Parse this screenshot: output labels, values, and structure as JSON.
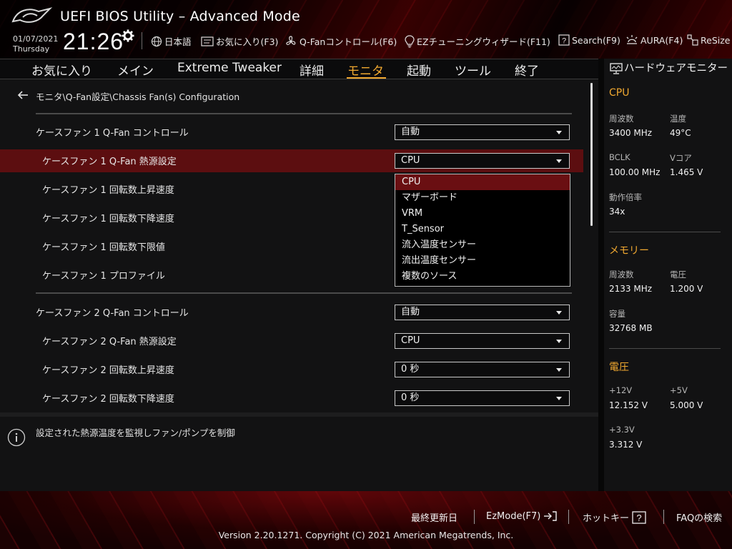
{
  "header": {
    "title": "UEFI BIOS Utility – Advanced Mode",
    "date": "01/07/2021",
    "weekday": "Thursday",
    "time": "21:26",
    "items": [
      {
        "label": "日本語",
        "icon": "globe-icon"
      },
      {
        "label": "お気に入り(F3)",
        "icon": "favorites-icon"
      },
      {
        "label": "Q-Fanコントロール(F6)",
        "icon": "fan-icon"
      },
      {
        "label": "EZチューニングウィザード(F11)",
        "icon": "bulb-icon"
      },
      {
        "label": "Search(F9)",
        "icon": "search-help-icon"
      },
      {
        "label": "AURA(F4)",
        "icon": "aura-icon"
      },
      {
        "label": "ReSize",
        "icon": "resize-icon"
      }
    ]
  },
  "nav": {
    "tabs": [
      "お気に入り",
      "メイン",
      "Extreme Tweaker",
      "詳細",
      "モニタ",
      "起動",
      "ツール",
      "終了"
    ],
    "active": "モニタ"
  },
  "main": {
    "breadcrumb": "モニタ\\Q-Fan設定\\Chassis Fan(s) Configuration",
    "rows": [
      {
        "label": "ケースファン 1 Q-Fan コントロール",
        "value": "自動"
      },
      {
        "label": "ケースファン 1 Q-Fan 熱源設定",
        "value": "CPU"
      },
      {
        "label": "ケースファン 1 回転数上昇速度",
        "value": ""
      },
      {
        "label": "ケースファン 1 回転数下降速度",
        "value": ""
      },
      {
        "label": "ケースファン 1 回転数下限値",
        "value": ""
      },
      {
        "label": "ケースファン 1 プロファイル",
        "value": ""
      },
      {
        "label": "ケースファン 2 Q-Fan コントロール",
        "value": "自動"
      },
      {
        "label": "ケースファン 2 Q-Fan 熱源設定",
        "value": "CPU"
      },
      {
        "label": "ケースファン 2 回転数上昇速度",
        "value": "0 秒"
      },
      {
        "label": "ケースファン 2 回転数下降速度",
        "value": "0 秒"
      }
    ],
    "dropdown_options": [
      "CPU",
      "マザーボード",
      "VRM",
      "T_Sensor",
      "流入温度センサー",
      "流出温度センサー",
      "複数のソース"
    ],
    "dropdown_selected": "CPU"
  },
  "help": {
    "text": "設定された熱源温度を監視しファン/ポンプを制御"
  },
  "hwmon": {
    "title": "ハードウェアモニター",
    "cpu": {
      "heading": "CPU",
      "freq_label": "周波数",
      "freq_value": "3400 MHz",
      "temp_label": "温度",
      "temp_value": "49°C",
      "bclk_label": "BCLK",
      "bclk_value": "100.00 MHz",
      "vcore_label": "Vコア",
      "vcore_value": "1.465 V",
      "ratio_label": "動作倍率",
      "ratio_value": "34x"
    },
    "memory": {
      "heading": "メモリー",
      "freq_label": "周波数",
      "freq_value": "2133 MHz",
      "volt_label": "電圧",
      "volt_value": "1.200 V",
      "cap_label": "容量",
      "cap_value": "32768 MB"
    },
    "voltage": {
      "heading": "電圧",
      "v12_label": "+12V",
      "v12_value": "12.152 V",
      "v5_label": "+5V",
      "v5_value": "5.000 V",
      "v33_label": "+3.3V",
      "v33_value": "3.312 V"
    }
  },
  "footer": {
    "last_modified": "最終更新日",
    "ezmode": "EzMode(F7)",
    "hotkeys": "ホットキー",
    "faq": "FAQの検索",
    "version": "Version 2.20.1271. Copyright (C) 2021 American Megatrends, Inc."
  },
  "colors": {
    "accent": "#f0a830",
    "highlight_row": "#5c0e10",
    "dropdown_selected": "#6a0f12"
  }
}
